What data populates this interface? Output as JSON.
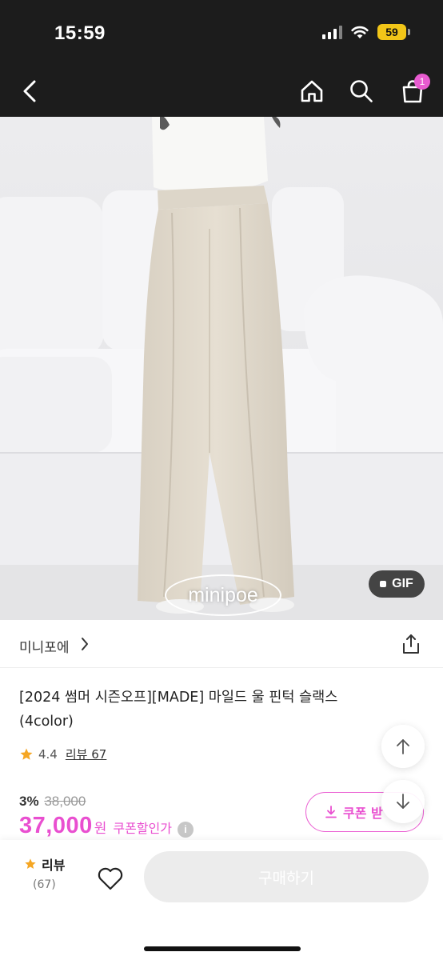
{
  "status_bar": {
    "time": "15:59",
    "battery": "59"
  },
  "nav": {
    "cart_count": "1",
    "icons": [
      "back-arrow-icon",
      "home-icon",
      "search-icon",
      "shopping-bag-icon"
    ]
  },
  "hero": {
    "watermark": "minipoe",
    "gif_label": "GIF"
  },
  "shop": {
    "name": "미니포에",
    "icons": [
      "chevron-right-icon",
      "share-icon"
    ]
  },
  "product": {
    "title": "[2024 썸머 시즌오프][MADE] 마일드 울 핀턱 슬랙스 (4color)",
    "rating": "4.4",
    "review_link": "리뷰 67"
  },
  "price": {
    "discount_rate": "3%",
    "original_price": "38,000",
    "price": "37,000",
    "currency": "원",
    "coupon_price_label": "쿠폰할인가",
    "info_icon": "i"
  },
  "coupon_button": {
    "label": "쿠폰 받"
  },
  "bottom_bar": {
    "review_label": "리뷰",
    "review_count": "(67)",
    "buy_label": "구매하기"
  },
  "colors": {
    "accent": "#e94fd0",
    "star": "#f5a623",
    "status_bg": "#1c1c1c",
    "badge": "#e85bd0"
  }
}
